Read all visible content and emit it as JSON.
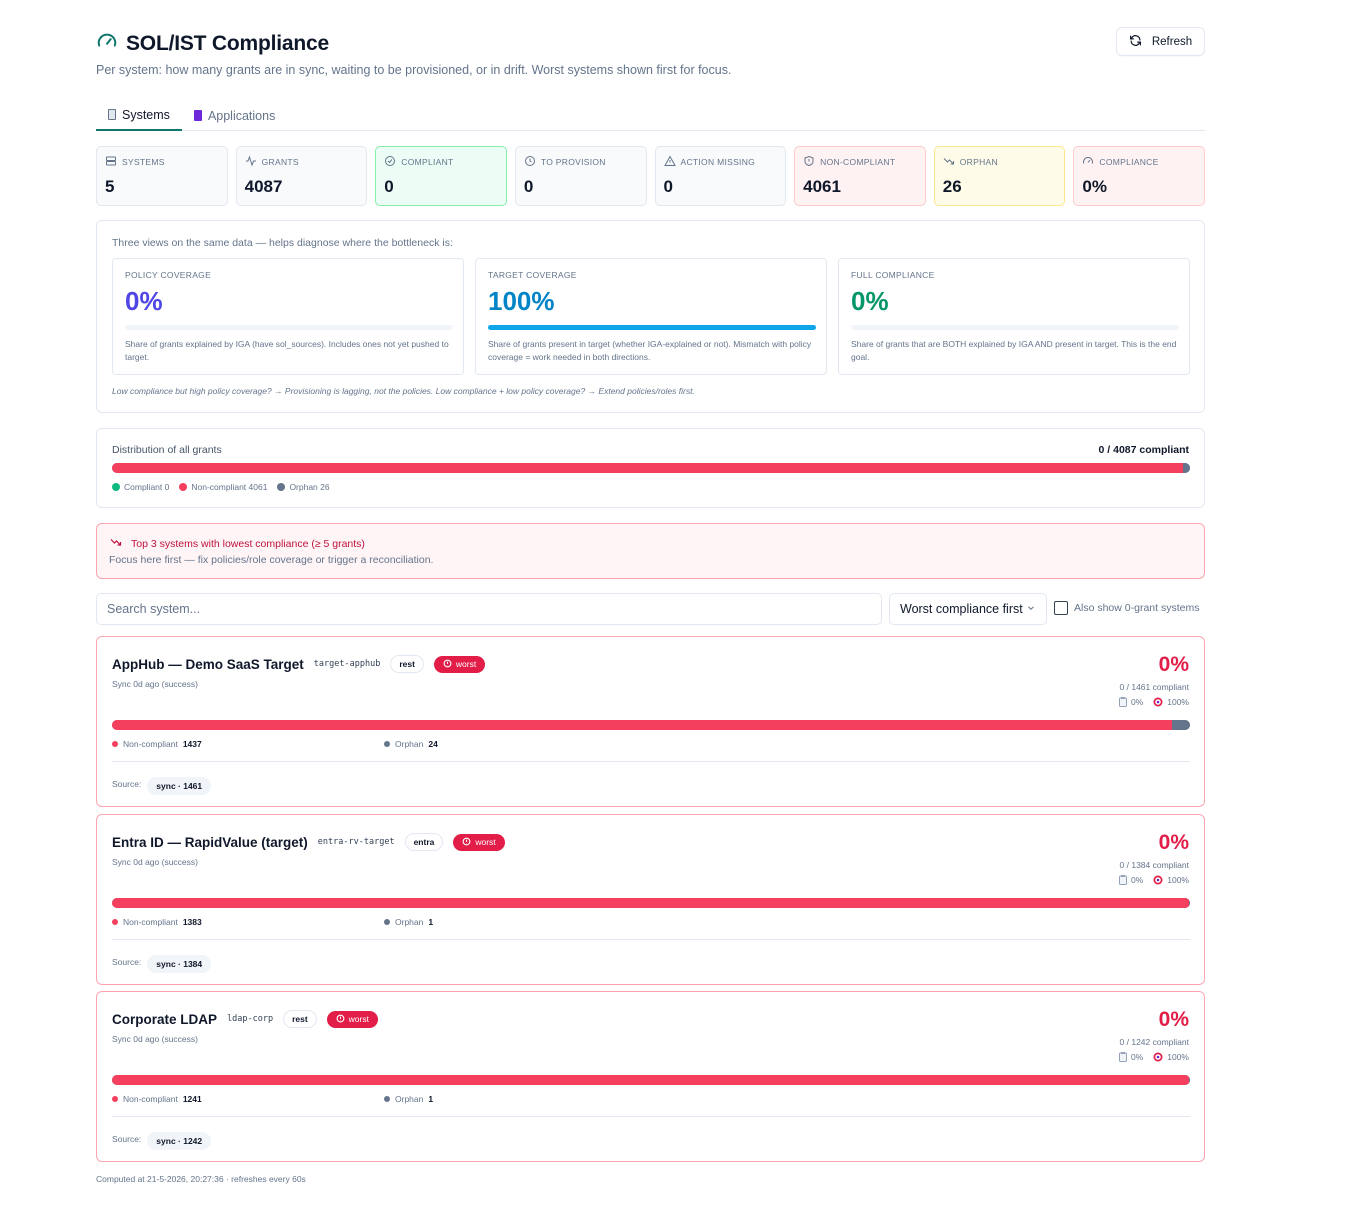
{
  "header": {
    "title": "SOL/IST Compliance",
    "subtitle": "Per system: how many grants are in sync, waiting to be provisioned, or in drift. Worst systems shown first for focus.",
    "refresh_label": "Refresh",
    "accent_color": "#0f766e"
  },
  "tabs": [
    {
      "label": "Systems",
      "icon": "server-icon",
      "active": true
    },
    {
      "label": "Applications",
      "icon": "app-icon",
      "active": false
    }
  ],
  "kpis": [
    {
      "label": "SYSTEMS",
      "value": "5",
      "icon": "server-icon",
      "tone": "neutral"
    },
    {
      "label": "GRANTS",
      "value": "4087",
      "icon": "activity-icon",
      "tone": "neutral"
    },
    {
      "label": "COMPLIANT",
      "value": "0",
      "icon": "check-circle-icon",
      "tone": "green"
    },
    {
      "label": "TO PROVISION",
      "value": "0",
      "icon": "clock-icon",
      "tone": "neutral"
    },
    {
      "label": "ACTION MISSING",
      "value": "0",
      "icon": "warning-icon",
      "tone": "neutral"
    },
    {
      "label": "NON-COMPLIANT",
      "value": "4061",
      "icon": "shield-alert-icon",
      "tone": "red"
    },
    {
      "label": "ORPHAN",
      "value": "26",
      "icon": "trend-down-icon",
      "tone": "yellow"
    },
    {
      "label": "COMPLIANCE",
      "value": "0%",
      "icon": "gauge-icon",
      "tone": "red"
    }
  ],
  "views": {
    "intro": "Three views on the same data — helps diagnose where the bottleneck is:",
    "cards": [
      {
        "label": "POLICY COVERAGE",
        "value": "0%",
        "fill": 0,
        "color": "#4f46e5",
        "desc": "Share of grants explained by IGA (have sol_sources). Includes ones not yet pushed to target."
      },
      {
        "label": "TARGET COVERAGE",
        "value": "100%",
        "fill": 1,
        "color": "#0284c7",
        "desc": "Share of grants present in target (whether IGA-explained or not). Mismatch with policy coverage = work needed in both directions."
      },
      {
        "label": "FULL COMPLIANCE",
        "value": "0%",
        "fill": 0,
        "color": "#059669",
        "desc": "Share of grants that are BOTH explained by IGA AND present in target. This is the end goal."
      }
    ],
    "note": "Low compliance but high policy coverage? → Provisioning is lagging, not the policies. Low compliance + low policy coverage? → Extend policies/roles first."
  },
  "distribution": {
    "title": "Distribution of all grants",
    "summary": "0 / 4087 compliant",
    "compliant": 0,
    "non_compliant": 4061,
    "orphan": 26,
    "legend": [
      {
        "label": "Compliant 0",
        "color": "#10b981"
      },
      {
        "label": "Non-compliant 4061",
        "color": "#f43f5e"
      },
      {
        "label": "Orphan 26",
        "color": "#64748b"
      }
    ]
  },
  "alert": {
    "title": "Top 3 systems with lowest compliance (≥ 5 grants)",
    "subtitle": "Focus here first — fix policies/role coverage or trigger a reconciliation."
  },
  "filters": {
    "search_placeholder": "Search system...",
    "sort_value": "Worst compliance first",
    "checkbox_label": "Also show 0-grant systems"
  },
  "systems": [
    {
      "name": "AppHub — Demo SaaS Target",
      "code": "target-apphub",
      "type": "rest",
      "badge": "worst",
      "sync": "Sync 0d ago (success)",
      "pct": "0%",
      "compliant_text": "0 / 1461 compliant",
      "policy": "0%",
      "target": "100%",
      "noncompliant_label": "Non-compliant",
      "noncompliant": "1437",
      "orphan_label": "Orphan",
      "orphan": "24",
      "source_label": "Source:",
      "source": "sync · 1461"
    },
    {
      "name": "Entra ID — RapidValue (target)",
      "code": "entra-rv-target",
      "type": "entra",
      "badge": "worst",
      "sync": "Sync 0d ago (success)",
      "pct": "0%",
      "compliant_text": "0 / 1384 compliant",
      "policy": "0%",
      "target": "100%",
      "noncompliant_label": "Non-compliant",
      "noncompliant": "1383",
      "orphan_label": "Orphan",
      "orphan": "1",
      "source_label": "Source:",
      "source": "sync · 1384"
    },
    {
      "name": "Corporate LDAP",
      "code": "ldap-corp",
      "type": "rest",
      "badge": "worst",
      "sync": "Sync 0d ago (success)",
      "pct": "0%",
      "compliant_text": "0 / 1242 compliant",
      "policy": "0%",
      "target": "100%",
      "noncompliant_label": "Non-compliant",
      "noncompliant": "1241",
      "orphan_label": "Orphan",
      "orphan": "1",
      "source_label": "Source:",
      "source": "sync · 1242"
    }
  ],
  "footer": "Computed at 21-5-2026, 20:27:36 · refreshes every 60s"
}
